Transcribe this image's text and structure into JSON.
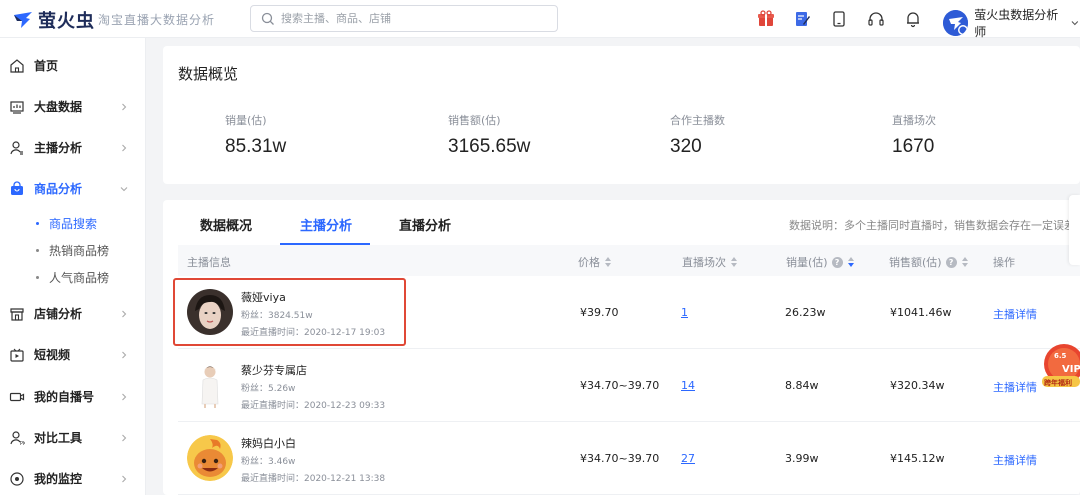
{
  "app": {
    "logo_text": "萤火虫",
    "slogan": "淘宝直播大数据分析"
  },
  "search": {
    "placeholder": "搜索主播、商品、店铺",
    "value": ""
  },
  "header_icons": [
    "gift-icon",
    "edit-doc-icon",
    "tablet-icon",
    "headset-icon",
    "bell-icon"
  ],
  "user": {
    "name": "萤火虫数据分析师"
  },
  "sidebar": {
    "items": [
      {
        "label": "首页",
        "icon": "home-icon",
        "has_chevron": false
      },
      {
        "label": "大盘数据",
        "icon": "dashboard-icon",
        "has_chevron": true
      },
      {
        "label": "主播分析",
        "icon": "user-analysis-icon",
        "has_chevron": true
      },
      {
        "label": "商品分析",
        "icon": "bag-icon",
        "has_chevron": true,
        "active": true,
        "expanded": true
      },
      {
        "label": "店铺分析",
        "icon": "store-icon",
        "has_chevron": true
      },
      {
        "label": "短视频",
        "icon": "video-icon",
        "has_chevron": true
      },
      {
        "label": "我的自播号",
        "icon": "live-camera-icon",
        "has_chevron": true
      },
      {
        "label": "对比工具",
        "icon": "compare-icon",
        "has_chevron": true
      },
      {
        "label": "我的监控",
        "icon": "monitor-icon",
        "has_chevron": true
      }
    ],
    "sub_items": [
      {
        "label": "商品搜索",
        "active": true
      },
      {
        "label": "热销商品榜",
        "active": false
      },
      {
        "label": "人气商品榜",
        "active": false
      }
    ]
  },
  "overview": {
    "title": "数据概览",
    "stats": [
      {
        "label": "销量(估)",
        "value": "85.31w"
      },
      {
        "label": "销售额(估)",
        "value": "3165.65w"
      },
      {
        "label": "合作主播数",
        "value": "320"
      },
      {
        "label": "直播场次",
        "value": "1670"
      }
    ]
  },
  "tabs": [
    {
      "label": "数据概况",
      "active": false
    },
    {
      "label": "主播分析",
      "active": true
    },
    {
      "label": "直播分析",
      "active": false
    }
  ],
  "data_note": "数据说明：多个主播同时直播时，销售数据会存在一定误差",
  "table": {
    "headers": {
      "anchor": "主播信息",
      "price": "价格",
      "sessions": "直播场次",
      "sales": "销量(估)",
      "revenue": "销售额(估)",
      "action": "操作"
    },
    "rows": [
      {
        "name": "薇娅viya",
        "fans": "粉丝：3824.51w",
        "last_live": "最近直播时间：2020-12-17 19:03",
        "price": "¥39.70",
        "sessions": "1",
        "sales": "26.23w",
        "revenue": "¥1041.46w",
        "action": "主播详情"
      },
      {
        "name": "蔡少芬专属店",
        "fans": "粉丝：5.26w",
        "last_live": "最近直播时间：2020-12-23 09:33",
        "price": "¥34.70~39.70",
        "sessions": "14",
        "sales": "8.84w",
        "revenue": "¥320.34w",
        "action": "主播详情"
      },
      {
        "name": "辣妈白小白",
        "fans": "粉丝：3.46w",
        "last_live": "最近直播时间：2020-12-21 13:38",
        "price": "¥34.70~39.70",
        "sessions": "27",
        "sales": "3.99w",
        "revenue": "¥145.12w",
        "action": "主播详情"
      }
    ]
  },
  "vip_badge": {
    "date": "6.5折",
    "label": "VIP",
    "caption": "跨年福利"
  },
  "colors": {
    "accent": "#2c68ff",
    "highlight_border": "#e04836",
    "brand_dark": "#1f2d5a"
  }
}
